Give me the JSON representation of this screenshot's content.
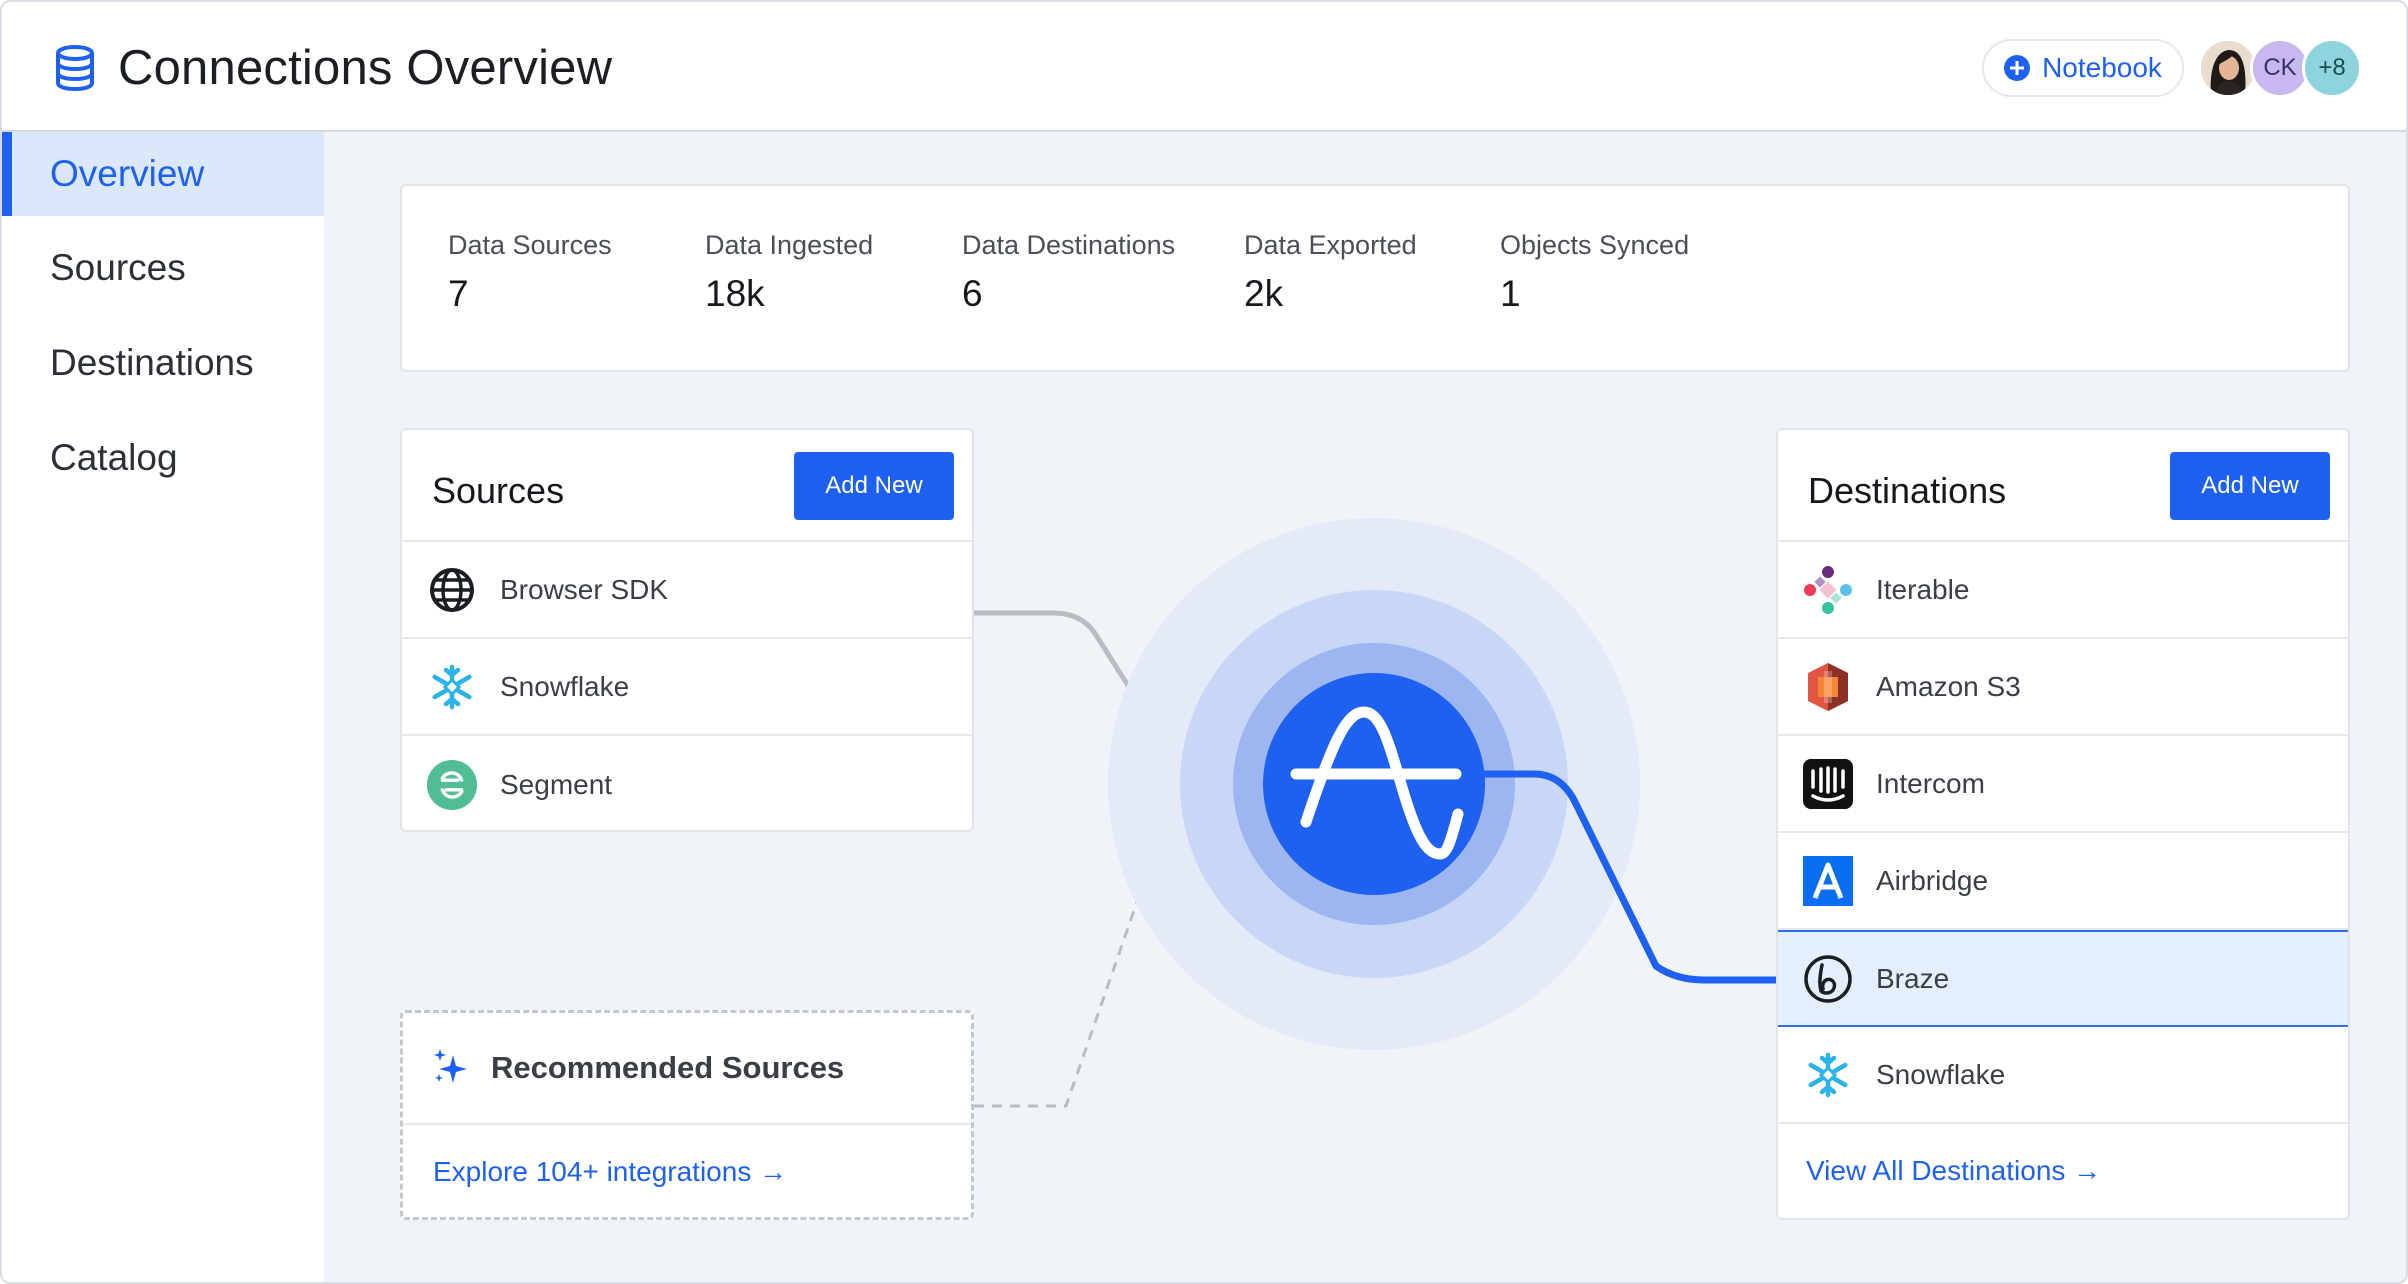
{
  "header": {
    "title": "Connections Overview",
    "notebook_label": "Notebook",
    "avatars": [
      {
        "type": "photo"
      },
      {
        "initials": "CK",
        "color": "#c9b8f0"
      },
      {
        "initials": "+8",
        "color": "#8fd3dc"
      }
    ]
  },
  "sidebar": {
    "items": [
      {
        "label": "Overview",
        "active": true
      },
      {
        "label": "Sources"
      },
      {
        "label": "Destinations"
      },
      {
        "label": "Catalog"
      }
    ]
  },
  "stats": [
    {
      "label": "Data Sources",
      "value": "7"
    },
    {
      "label": "Data Ingested",
      "value": "18k"
    },
    {
      "label": "Data Destinations",
      "value": "6"
    },
    {
      "label": "Data Exported",
      "value": "2k"
    },
    {
      "label": "Objects Synced",
      "value": "1"
    }
  ],
  "sources": {
    "title": "Sources",
    "add_label": "Add New",
    "items": [
      {
        "label": "Browser SDK",
        "icon": "globe-icon"
      },
      {
        "label": "Snowflake",
        "icon": "snowflake-icon"
      },
      {
        "label": "Segment",
        "icon": "segment-icon"
      }
    ]
  },
  "recommended": {
    "title": "Recommended Sources",
    "link": "Explore 104+ integrations →"
  },
  "destinations": {
    "title": "Destinations",
    "add_label": "Add New",
    "items": [
      {
        "label": "Iterable",
        "icon": "iterable-icon"
      },
      {
        "label": "Amazon S3",
        "icon": "amazon-s3-icon"
      },
      {
        "label": "Intercom",
        "icon": "intercom-icon"
      },
      {
        "label": "Airbridge",
        "icon": "airbridge-icon"
      },
      {
        "label": "Braze",
        "icon": "braze-icon",
        "selected": true
      },
      {
        "label": "Snowflake",
        "icon": "snowflake-icon"
      }
    ],
    "view_all": "View All Destinations →"
  },
  "colors": {
    "accent": "#1e61f0",
    "background": "#f0f3f8",
    "selected_row": "#e4eefc"
  }
}
